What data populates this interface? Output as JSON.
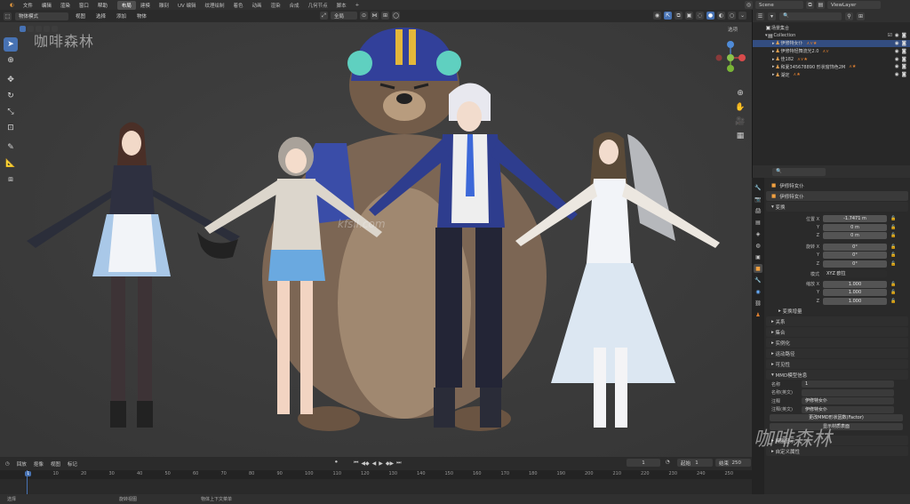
{
  "top_menu": {
    "items": [
      "文件",
      "编辑",
      "渲染",
      "窗口",
      "帮助"
    ],
    "tabs": [
      "布局",
      "建模",
      "雕刻",
      "UV 编辑",
      "纹理绘制",
      "着色",
      "动画",
      "渲染",
      "合成",
      "几何节点",
      "脚本"
    ],
    "active_tab": "布局",
    "scene": "Scene",
    "view_layer": "ViewLayer"
  },
  "viewport": {
    "mode": "物体模式",
    "menus": [
      "视图",
      "选择",
      "添加",
      "物体"
    ],
    "transform_orientation": "全局",
    "options_label": "选项",
    "watermark": "咖啡森林",
    "watermark_url": "kfsll.com"
  },
  "timeline": {
    "menus": [
      "回放",
      "抠像",
      "视图",
      "标记"
    ],
    "current_frame": "1",
    "start_label": "起始",
    "start": "1",
    "end_label": "结束",
    "end": "250",
    "ticks": [
      "1",
      "10",
      "20",
      "30",
      "40",
      "50",
      "60",
      "70",
      "80",
      "90",
      "100",
      "110",
      "120",
      "130",
      "140",
      "150",
      "160",
      "170",
      "180",
      "190",
      "200",
      "210",
      "220",
      "230",
      "240",
      "250"
    ]
  },
  "status_bar": {
    "items": [
      "选择",
      "旋转视图",
      "物体上下文菜单"
    ]
  },
  "outliner": {
    "root": "场景集合",
    "collection": "Collection",
    "items": [
      {
        "name": "伊修特女仆",
        "selected": true
      },
      {
        "name": "伊修特轻舞流光2.0",
        "selected": false
      },
      {
        "name": "佳182",
        "selected": false
      },
      {
        "name": "和夏345678890 形状窗饰色2M",
        "selected": false
      },
      {
        "name": "湖定",
        "selected": false
      }
    ]
  },
  "properties": {
    "object_name": "伊修特女仆",
    "data_name": "伊修特女仆",
    "transform_label": "变换",
    "location_label": "位置 X",
    "location": [
      "-1.7471 m",
      "0 m",
      "0 m"
    ],
    "rotation_label": "旋转 X",
    "rotation": [
      "0°",
      "0°",
      "0°"
    ],
    "mode_label": "模式",
    "rotation_mode": "XYZ 欧拉",
    "scale_label": "缩放 X",
    "scale": [
      "1.000",
      "1.000",
      "1.000"
    ],
    "delta_label": "变换增量",
    "panels": [
      "关系",
      "集合",
      "实例化",
      "运动路径",
      "可见性"
    ],
    "mmd_panel": "MMD模型信息",
    "mmd_name_label": "名称",
    "mmd_name": "1",
    "mmd_name_en_label": "名称(英文)",
    "mmd_comment_label": "注释",
    "mmd_comment": "伊修特女仆",
    "mmd_comment_en_label": "注释(英文)",
    "mmd_comment_en": "伊修特女仆",
    "mmd_btn1": "更改MMD形状因数(Factor)",
    "mmd_btn2": "显示材质表面",
    "bottom_panels": [
      "视图显示",
      "自定义属性"
    ],
    "watermark": "咖啡森林"
  },
  "colors": {
    "accent": "#4772b3",
    "selected_row": "#334d80",
    "viewport_bg": "#3c3c3c"
  }
}
